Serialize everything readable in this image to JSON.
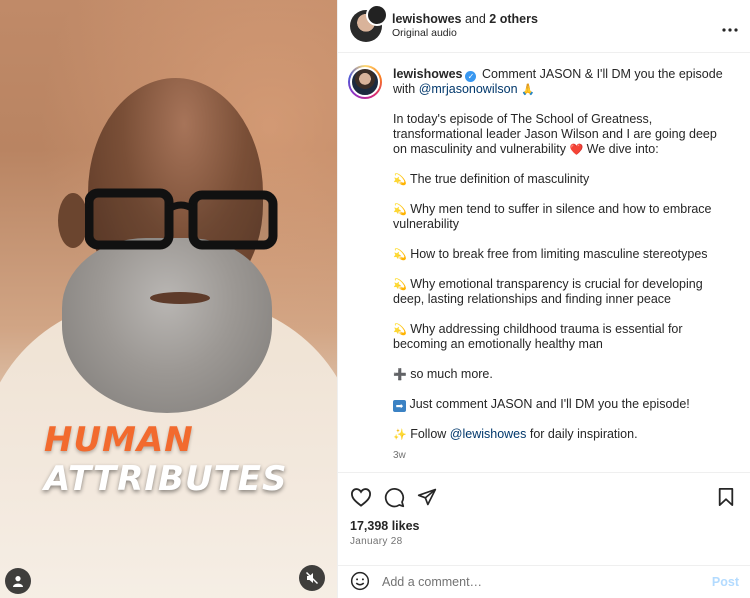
{
  "header": {
    "username": "lewishowes",
    "collab_suffix": " and ",
    "collab_others": "2 others",
    "audio": "Original audio",
    "more_icon": "more-horizontal-icon"
  },
  "media": {
    "overlay_line1": "HUMAN",
    "overlay_line2": "ATTRIBUTES",
    "user_icon": "person-icon",
    "mute_icon": "muted-speaker-icon"
  },
  "caption": {
    "username": "lewishowes",
    "intro_text": "Comment JASON & I'll DM you the episode with ",
    "intro_mention": "@mrjasonowilson",
    "intro_emoji": "🙏",
    "para1": "In today's episode of The School of Greatness, transformational leader Jason Wilson and I are going deep on masculinity and vulnerability",
    "para1_emoji": "❤️",
    "para1_end": " We dive into:",
    "bullets": [
      "The true definition of masculinity",
      "Why men tend to suffer in silence and how to embrace vulnerability",
      "How to break free from limiting masculine stereotypes",
      "Why emotional transparency is crucial for developing deep, lasting relationships and finding inner peace",
      "Why addressing childhood trauma is essential for becoming an emotionally healthy man"
    ],
    "bullet_emoji": "💫",
    "plus_line": "so much more.",
    "cta": "Just comment JASON and I'll DM you the episode!",
    "follow_prefix": "Follow ",
    "follow_mention": "@lewishowes",
    "follow_suffix": " for daily inspiration.",
    "time": "3w"
  },
  "actions": {
    "likes": "17,398 likes",
    "date": "January 28"
  },
  "comment": {
    "placeholder": "Add a comment…",
    "post_label": "Post"
  },
  "colors": {
    "link": "#00376b",
    "verified": "#3897f0",
    "overlay_orange": "#f26a2e",
    "post_disabled": "#b3dbff"
  }
}
